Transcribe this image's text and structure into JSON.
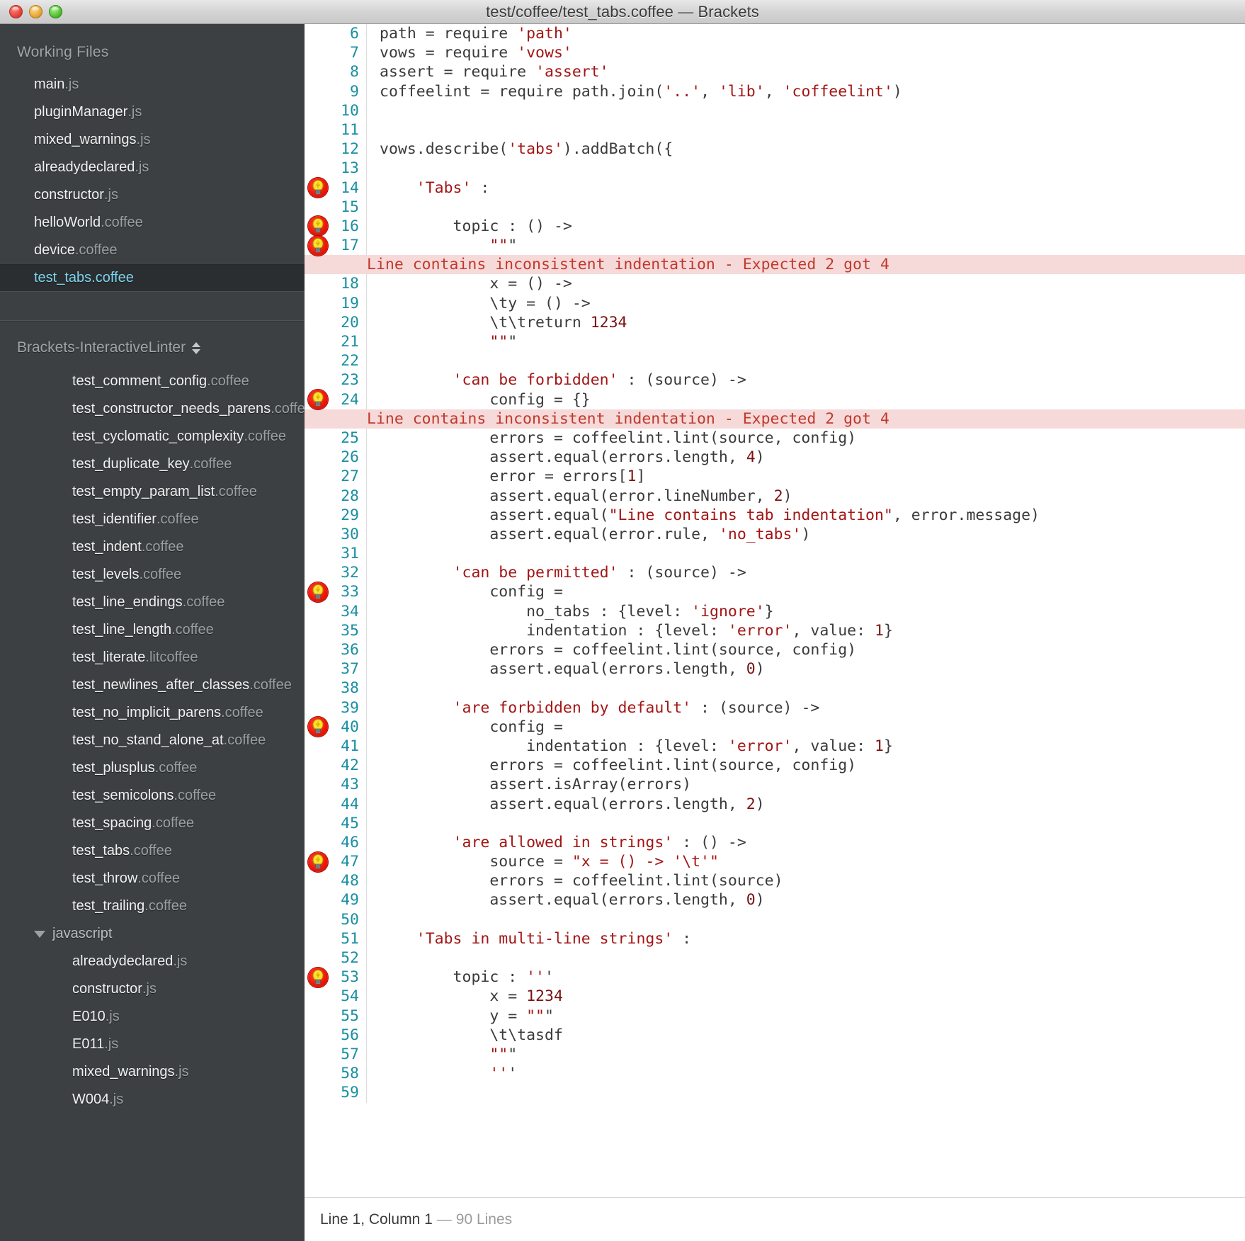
{
  "window": {
    "title": "test/coffee/test_tabs.coffee — Brackets",
    "controls": [
      "close",
      "minimize",
      "maximize"
    ]
  },
  "sidebar": {
    "working_files_header": "Working Files",
    "working_files": [
      {
        "name": "main",
        "ext": ".js",
        "selected": false
      },
      {
        "name": "pluginManager",
        "ext": ".js",
        "selected": false
      },
      {
        "name": "mixed_warnings",
        "ext": ".js",
        "selected": false
      },
      {
        "name": "alreadydeclared",
        "ext": ".js",
        "selected": false
      },
      {
        "name": "constructor",
        "ext": ".js",
        "selected": false
      },
      {
        "name": "helloWorld",
        "ext": ".coffee",
        "selected": false
      },
      {
        "name": "device",
        "ext": ".coffee",
        "selected": false
      },
      {
        "name": "test_tabs",
        "ext": ".coffee",
        "selected": true
      }
    ],
    "project_header": "Brackets-InteractiveLinter",
    "tree": [
      {
        "name": "test_comment_config",
        "ext": ".coffee",
        "type": "file"
      },
      {
        "name": "test_constructor_needs_parens",
        "ext": ".coffee",
        "type": "file"
      },
      {
        "name": "test_cyclomatic_complexity",
        "ext": ".coffee",
        "type": "file"
      },
      {
        "name": "test_duplicate_key",
        "ext": ".coffee",
        "type": "file"
      },
      {
        "name": "test_empty_param_list",
        "ext": ".coffee",
        "type": "file"
      },
      {
        "name": "test_identifier",
        "ext": ".coffee",
        "type": "file"
      },
      {
        "name": "test_indent",
        "ext": ".coffee",
        "type": "file"
      },
      {
        "name": "test_levels",
        "ext": ".coffee",
        "type": "file"
      },
      {
        "name": "test_line_endings",
        "ext": ".coffee",
        "type": "file"
      },
      {
        "name": "test_line_length",
        "ext": ".coffee",
        "type": "file"
      },
      {
        "name": "test_literate",
        "ext": ".litcoffee",
        "type": "file"
      },
      {
        "name": "test_newlines_after_classes",
        "ext": ".coffee",
        "type": "file"
      },
      {
        "name": "test_no_implicit_parens",
        "ext": ".coffee",
        "type": "file"
      },
      {
        "name": "test_no_stand_alone_at",
        "ext": ".coffee",
        "type": "file"
      },
      {
        "name": "test_plusplus",
        "ext": ".coffee",
        "type": "file"
      },
      {
        "name": "test_semicolons",
        "ext": ".coffee",
        "type": "file"
      },
      {
        "name": "test_spacing",
        "ext": ".coffee",
        "type": "file"
      },
      {
        "name": "test_tabs",
        "ext": ".coffee",
        "type": "file"
      },
      {
        "name": "test_throw",
        "ext": ".coffee",
        "type": "file"
      },
      {
        "name": "test_trailing",
        "ext": ".coffee",
        "type": "file"
      },
      {
        "name": "javascript",
        "ext": "",
        "type": "folder",
        "expanded": true
      },
      {
        "name": "alreadydeclared",
        "ext": ".js",
        "type": "file"
      },
      {
        "name": "constructor",
        "ext": ".js",
        "type": "file"
      },
      {
        "name": "E010",
        "ext": ".js",
        "type": "file"
      },
      {
        "name": "E011",
        "ext": ".js",
        "type": "file"
      },
      {
        "name": "mixed_warnings",
        "ext": ".js",
        "type": "file"
      },
      {
        "name": "W004",
        "ext": ".js",
        "type": "file"
      }
    ]
  },
  "editor": {
    "error_message": "Line contains inconsistent indentation - Expected 2 got 4",
    "lines": [
      {
        "n": "6",
        "bulb": false,
        "text": "path = require 'path'"
      },
      {
        "n": "7",
        "bulb": false,
        "text": "vows = require 'vows'"
      },
      {
        "n": "8",
        "bulb": false,
        "text": "assert = require 'assert'"
      },
      {
        "n": "9",
        "bulb": false,
        "text": "coffeelint = require path.join('..', 'lib', 'coffeelint')"
      },
      {
        "n": "10",
        "bulb": false,
        "text": ""
      },
      {
        "n": "11",
        "bulb": false,
        "text": ""
      },
      {
        "n": "12",
        "bulb": false,
        "text": "vows.describe('tabs').addBatch({"
      },
      {
        "n": "13",
        "bulb": false,
        "text": ""
      },
      {
        "n": "14",
        "bulb": true,
        "text": "    'Tabs' :"
      },
      {
        "n": "15",
        "bulb": false,
        "text": ""
      },
      {
        "n": "16",
        "bulb": true,
        "text": "        topic : () ->"
      },
      {
        "n": "17",
        "bulb": true,
        "text": "            \"\"\""
      },
      {
        "n": "err1",
        "banner": true
      },
      {
        "n": "18",
        "bulb": false,
        "text": "            x = () ->"
      },
      {
        "n": "19",
        "bulb": false,
        "text": "            \\ty = () ->"
      },
      {
        "n": "20",
        "bulb": false,
        "text": "            \\t\\treturn 1234"
      },
      {
        "n": "21",
        "bulb": false,
        "text": "            \"\"\""
      },
      {
        "n": "22",
        "bulb": false,
        "text": ""
      },
      {
        "n": "23",
        "bulb": false,
        "text": "        'can be forbidden' : (source) ->"
      },
      {
        "n": "24",
        "bulb": true,
        "text": "            config = {}"
      },
      {
        "n": "err2",
        "banner": true
      },
      {
        "n": "25",
        "bulb": false,
        "text": "            errors = coffeelint.lint(source, config)"
      },
      {
        "n": "26",
        "bulb": false,
        "text": "            assert.equal(errors.length, 4)"
      },
      {
        "n": "27",
        "bulb": false,
        "text": "            error = errors[1]"
      },
      {
        "n": "28",
        "bulb": false,
        "text": "            assert.equal(error.lineNumber, 2)"
      },
      {
        "n": "29",
        "bulb": false,
        "text": "            assert.equal(\"Line contains tab indentation\", error.message)"
      },
      {
        "n": "30",
        "bulb": false,
        "text": "            assert.equal(error.rule, 'no_tabs')"
      },
      {
        "n": "31",
        "bulb": false,
        "text": ""
      },
      {
        "n": "32",
        "bulb": false,
        "text": "        'can be permitted' : (source) ->"
      },
      {
        "n": "33",
        "bulb": true,
        "text": "            config ="
      },
      {
        "n": "34",
        "bulb": false,
        "text": "                no_tabs : {level: 'ignore'}"
      },
      {
        "n": "35",
        "bulb": false,
        "text": "                indentation : {level: 'error', value: 1}"
      },
      {
        "n": "36",
        "bulb": false,
        "text": "            errors = coffeelint.lint(source, config)"
      },
      {
        "n": "37",
        "bulb": false,
        "text": "            assert.equal(errors.length, 0)"
      },
      {
        "n": "38",
        "bulb": false,
        "text": ""
      },
      {
        "n": "39",
        "bulb": false,
        "text": "        'are forbidden by default' : (source) ->"
      },
      {
        "n": "40",
        "bulb": true,
        "text": "            config ="
      },
      {
        "n": "41",
        "bulb": false,
        "text": "                indentation : {level: 'error', value: 1}"
      },
      {
        "n": "42",
        "bulb": false,
        "text": "            errors = coffeelint.lint(source, config)"
      },
      {
        "n": "43",
        "bulb": false,
        "text": "            assert.isArray(errors)"
      },
      {
        "n": "44",
        "bulb": false,
        "text": "            assert.equal(errors.length, 2)"
      },
      {
        "n": "45",
        "bulb": false,
        "text": ""
      },
      {
        "n": "46",
        "bulb": false,
        "text": "        'are allowed in strings' : () ->"
      },
      {
        "n": "47",
        "bulb": true,
        "text": "            source = \"x = () -> '\\t'\""
      },
      {
        "n": "48",
        "bulb": false,
        "text": "            errors = coffeelint.lint(source)"
      },
      {
        "n": "49",
        "bulb": false,
        "text": "            assert.equal(errors.length, 0)"
      },
      {
        "n": "50",
        "bulb": false,
        "text": ""
      },
      {
        "n": "51",
        "bulb": false,
        "text": "    'Tabs in multi-line strings' :"
      },
      {
        "n": "52",
        "bulb": false,
        "text": ""
      },
      {
        "n": "53",
        "bulb": true,
        "text": "        topic : '''"
      },
      {
        "n": "54",
        "bulb": false,
        "text": "            x = 1234"
      },
      {
        "n": "55",
        "bulb": false,
        "text": "            y = \"\"\""
      },
      {
        "n": "56",
        "bulb": false,
        "text": "            \\t\\tasdf"
      },
      {
        "n": "57",
        "bulb": false,
        "text": "            \"\"\""
      },
      {
        "n": "58",
        "bulb": false,
        "text": "            '''"
      },
      {
        "n": "59",
        "bulb": false,
        "text": ""
      }
    ]
  },
  "statusbar": {
    "cursor": "Line 1, Column 1",
    "dash": "—",
    "line_count": "90 Lines"
  },
  "colors": {
    "sidebar_bg": "#3c4043",
    "selected_fg": "#7fd4f0",
    "gutter_fg": "#1a8fa3",
    "error_bg": "#f6d9d9",
    "error_fg": "#c0392b",
    "string_fg": "#a31515",
    "bulb_red": "#f01707"
  }
}
